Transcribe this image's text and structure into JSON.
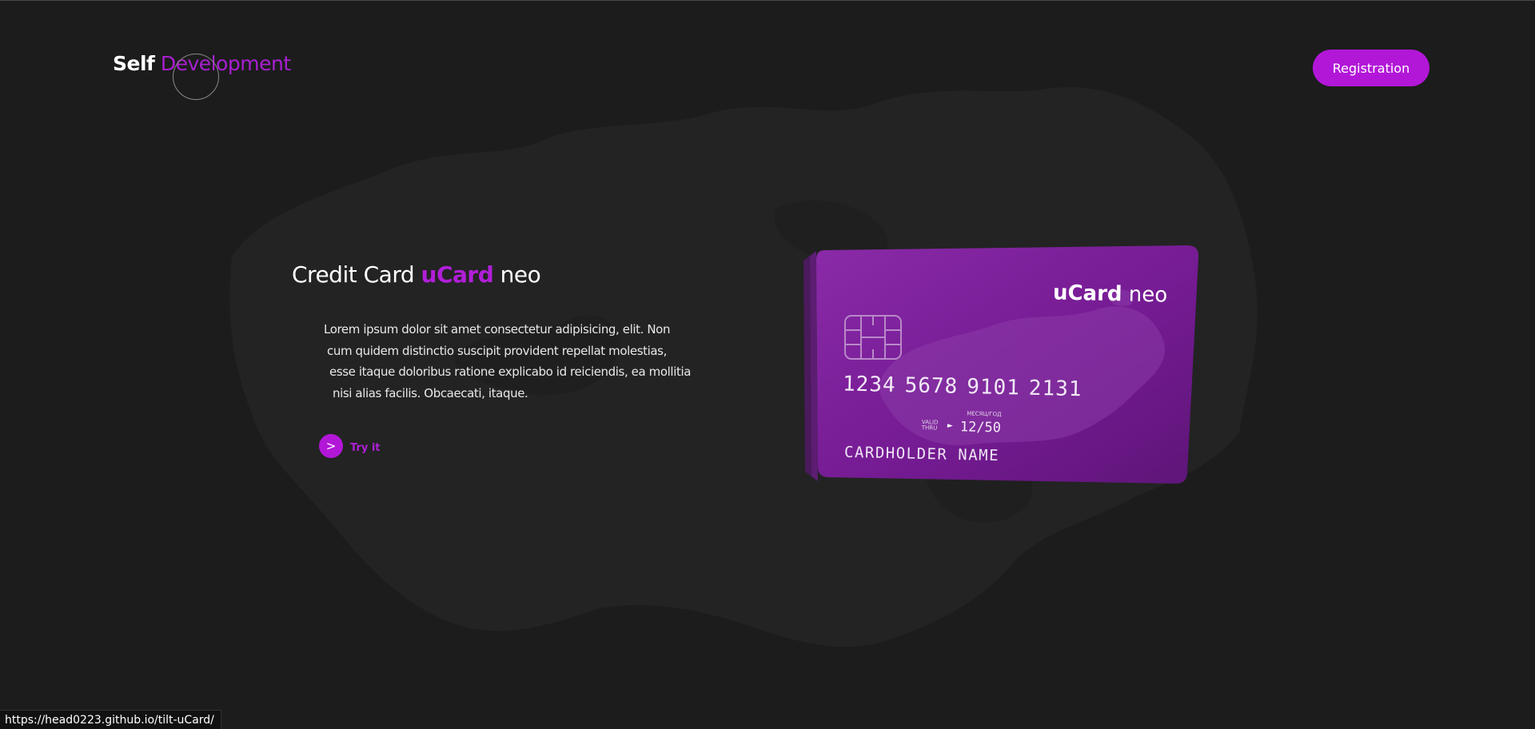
{
  "header": {
    "logo_part1": "Self",
    "logo_part2": "Development",
    "registration_label": "Registration"
  },
  "hero": {
    "title_prefix": "Credit Card",
    "title_brand": "uCard",
    "title_suffix": "neo",
    "description_lines": [
      "Lorem ipsum dolor sit amet consectetur adipisicing, elit. Non",
      "cum quidem distinctio suscipit provident repellat molestias,",
      "esse itaque doloribus ratione explicabo id reiciendis, ea mollitia",
      "nisi alias facilis. Obcaecati, itaque."
    ],
    "try_icon": ">",
    "try_label": "Try it"
  },
  "card": {
    "brand_bold": "uCard",
    "brand_light": "neo",
    "number_groups": [
      "1234",
      "5678",
      "9101",
      "2131"
    ],
    "valid_line1": "VALID",
    "valid_line2": "THRU",
    "month_year_label": "МЕСЯЦ/ГОД",
    "expiry": "12/50",
    "holder": "CARDHOLDER NAME"
  },
  "status_bar": {
    "url": "https://head0223.github.io/tilt-uCard/"
  },
  "colors": {
    "background": "#1c1c1c",
    "accent": "#b217d8",
    "card": "#7d1f9a",
    "text": "#ffffff"
  },
  "icons": {
    "chip": "sim-chip-icon",
    "arrow": "chevron-right-icon",
    "play": "triangle-right-icon"
  }
}
